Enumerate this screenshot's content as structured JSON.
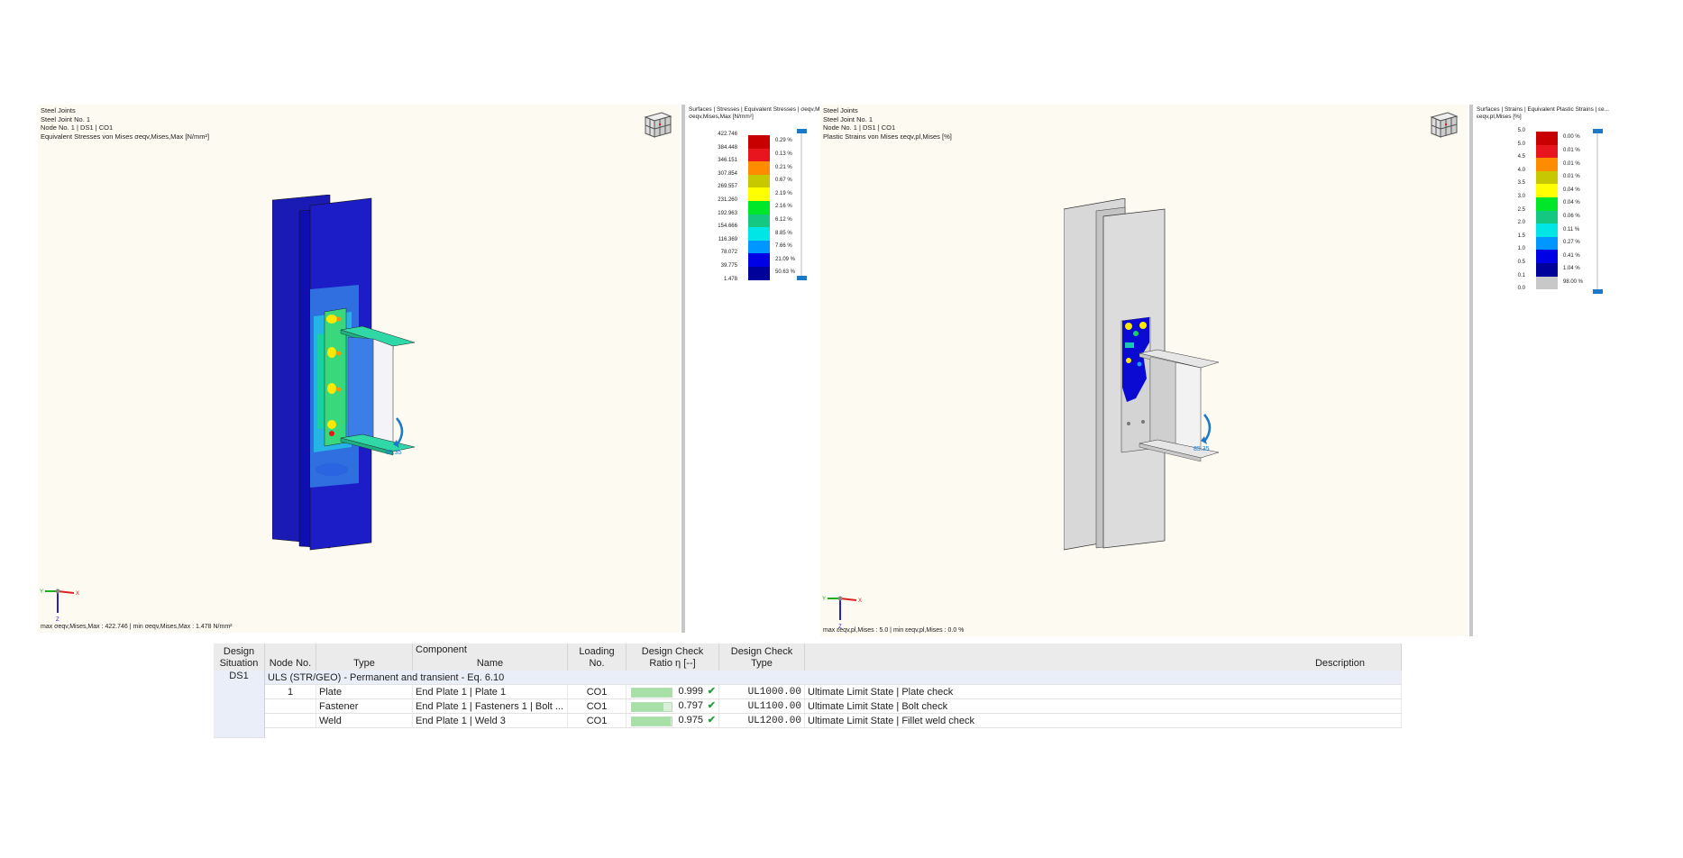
{
  "left_view": {
    "header": [
      "Steel Joints",
      "Steel Joint No. 1",
      "Node No. 1 | DS1 | CO1",
      "Equivalent Stresses von Mises σeqv,Mises,Max [N/mm²]"
    ],
    "footer": "max σeqv,Mises,Max : 422.746 | min σeqv,Mises,Max : 1.478 N/mm²",
    "moment_label": "85.35"
  },
  "left_legend": {
    "title": "Surfaces | Stresses | Equivalent Stresses | σeqv,M...",
    "subtitle": "σeqv,Mises,Max [N/mm²]",
    "values": [
      "422.746",
      "384.448",
      "346.151",
      "307.854",
      "269.557",
      "231.260",
      "192.963",
      "154.666",
      "116.369",
      "78.072",
      "39.775",
      "1.478"
    ],
    "percents": [
      "0.29 %",
      "0.13 %",
      "0.21 %",
      "0.67 %",
      "2.19 %",
      "2.16 %",
      "6.12 %",
      "8.85 %",
      "7.66 %",
      "21.09 %",
      "50.63 %"
    ],
    "colors": [
      "#c80000",
      "#e8141e",
      "#ff8c00",
      "#c8c800",
      "#ffff00",
      "#00e628",
      "#14c882",
      "#00e6e6",
      "#0096ff",
      "#0000e6",
      "#00009a"
    ]
  },
  "right_view": {
    "header": [
      "Steel Joints",
      "Steel Joint No. 1",
      "Node No. 1 | DS1 | CO1",
      "Plastic Strains von Mises εeqv,pl,Mises [%]"
    ],
    "footer": "max εeqv,pl,Mises : 5.0 | min εeqv,pl,Mises : 0.0 %",
    "moment_label": "85.35"
  },
  "right_legend": {
    "title": "Surfaces | Strains | Equivalent Plastic Strains | εe...",
    "subtitle": "εeqv,pl,Mises [%]",
    "values": [
      "5.0",
      "5.0",
      "4.5",
      "4.0",
      "3.5",
      "3.0",
      "2.5",
      "2.0",
      "1.5",
      "1.0",
      "0.5",
      "0.1",
      "0.0"
    ],
    "percents": [
      "0.00 %",
      "0.01 %",
      "0.01 %",
      "0.01 %",
      "0.04 %",
      "0.04 %",
      "0.06 %",
      "0.11 %",
      "0.27 %",
      "0.41 %",
      "1.04 %",
      "98.00 %"
    ],
    "colors": [
      "#c80000",
      "#e8141e",
      "#ff8c00",
      "#c8c800",
      "#ffff00",
      "#00e628",
      "#14c882",
      "#00e6e6",
      "#0096ff",
      "#0000e6",
      "#00009a",
      "#c8c8c8"
    ]
  },
  "axes": {
    "x": "X",
    "y": "Y",
    "z": "Z"
  },
  "table": {
    "headers": {
      "design_situation": "Design Situation",
      "node_no": "Node No.",
      "component": "Component",
      "type": "Type",
      "name": "Name",
      "loading_no": "Loading No.",
      "ratio": "Design Check Ratio η [--]",
      "check_type": "Design Check Type",
      "description": "Description"
    },
    "design_situation": "DS1",
    "group_label": "ULS (STR/GEO) - Permanent and transient - Eq. 6.10",
    "rows": [
      {
        "node": "1",
        "type": "Plate",
        "name": "End Plate 1 | Plate 1",
        "loading": "CO1",
        "ratio": "0.999",
        "ratio_value": 0.999,
        "check_type": "UL1000.00",
        "description": "Ultimate Limit State | Plate check"
      },
      {
        "node": "",
        "type": "Fastener",
        "name": "End Plate 1 | Fasteners 1 | Bolt ...",
        "loading": "CO1",
        "ratio": "0.797",
        "ratio_value": 0.797,
        "check_type": "UL1100.00",
        "description": "Ultimate Limit State | Bolt check"
      },
      {
        "node": "",
        "type": "Weld",
        "name": "End Plate 1 | Weld 3",
        "loading": "CO1",
        "ratio": "0.975",
        "ratio_value": 0.975,
        "check_type": "UL1200.00",
        "description": "Ultimate Limit State | Fillet weld check"
      }
    ]
  }
}
